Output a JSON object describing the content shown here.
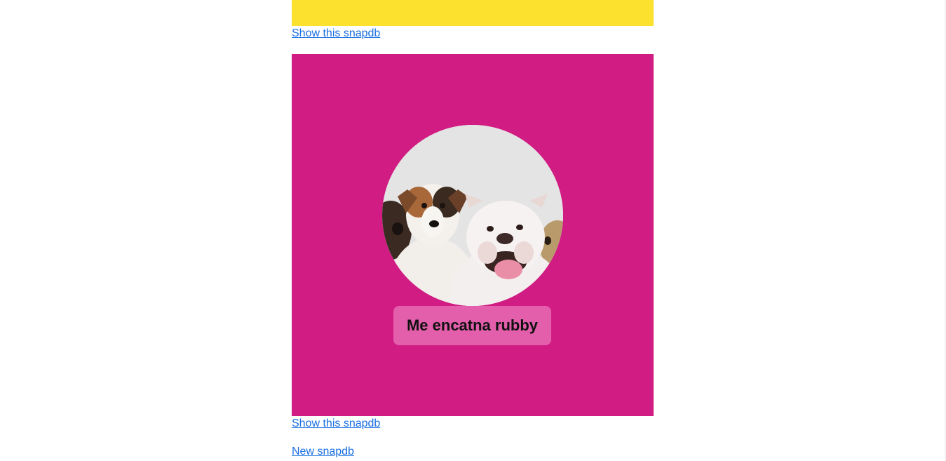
{
  "colors": {
    "link": "#1a6fe0",
    "card_top_bg": "#fce22f",
    "card_main_bg": "#d11c84",
    "caption_bg": "#e35eab"
  },
  "snaps": [
    {
      "show_link": "Show this snapdb"
    },
    {
      "image": "two-dogs-photo",
      "caption": "Me encatna rubby",
      "show_link": "Show this snapdb"
    }
  ],
  "new_link": "New snapdb"
}
